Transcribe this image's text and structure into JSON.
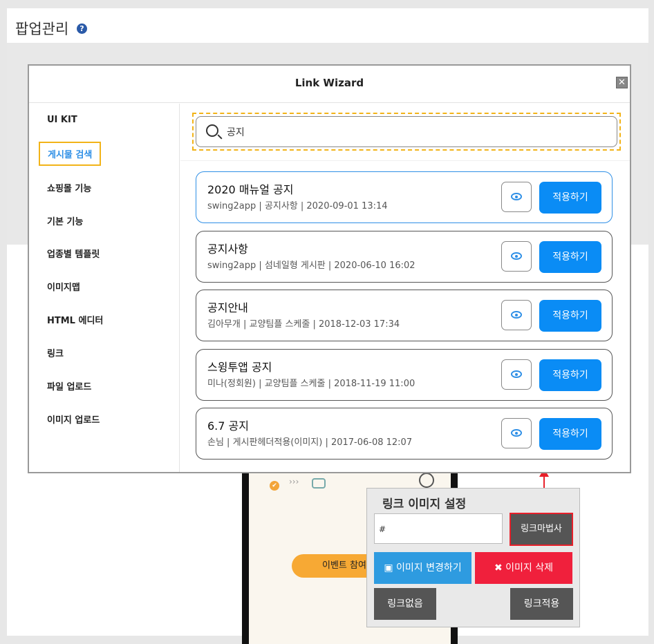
{
  "page": {
    "title": "팝업관리",
    "help_icon": "question-circle-icon"
  },
  "modal": {
    "title": "Link Wizard",
    "close_icon": "close-icon",
    "sidebar": {
      "items": [
        {
          "label": "UI KIT"
        },
        {
          "label": "게시물 검색"
        },
        {
          "label": "쇼핑몰 기능"
        },
        {
          "label": "기본 기능"
        },
        {
          "label": "업종별 템플릿"
        },
        {
          "label": "이미지맵"
        },
        {
          "label": "HTML 에디터"
        },
        {
          "label": "링크"
        },
        {
          "label": "파일 업로드"
        },
        {
          "label": "이미지 업로드"
        }
      ],
      "active_index": 1
    },
    "search": {
      "value": "공지",
      "icon": "search-icon"
    },
    "results": [
      {
        "title": "2020 매뉴얼 공지",
        "meta": "swing2app | 공지사항 | 2020-09-01 13:14",
        "apply_label": "적용하기"
      },
      {
        "title": "공지사항",
        "meta": "swing2app | 섬네일형 게시판 | 2020-06-10 16:02",
        "apply_label": "적용하기"
      },
      {
        "title": "공지안내",
        "meta": "김아무개 | 교양팀플 스케줄 | 2018-12-03 17:34",
        "apply_label": "적용하기"
      },
      {
        "title": "스윙투앱 공지",
        "meta": "미나(정회원) | 교양팀플 스케줄 | 2018-11-19 11:00",
        "apply_label": "적용하기"
      },
      {
        "title": "6.7 공지",
        "meta": "손님 | 게시판헤더적용(이미지) | 2017-06-08 12:07",
        "apply_label": "적용하기"
      }
    ]
  },
  "phone": {
    "arrows": "›››",
    "event_button": "이벤트 참여하"
  },
  "link_panel": {
    "title": "링크 이미지 설정",
    "input_value": "#",
    "wizard_button": "링크마법사",
    "change_image_button": "이미지 변경하기",
    "delete_image_button": "이미지 삭제",
    "no_link_button": "링크없음",
    "apply_link_button": "링크적용"
  },
  "colors": {
    "accent_blue": "#0a8cf5",
    "highlight_yellow": "#f2b318",
    "delete_red": "#f0203c",
    "change_blue": "#2e9be0",
    "dark_button": "#555555"
  }
}
